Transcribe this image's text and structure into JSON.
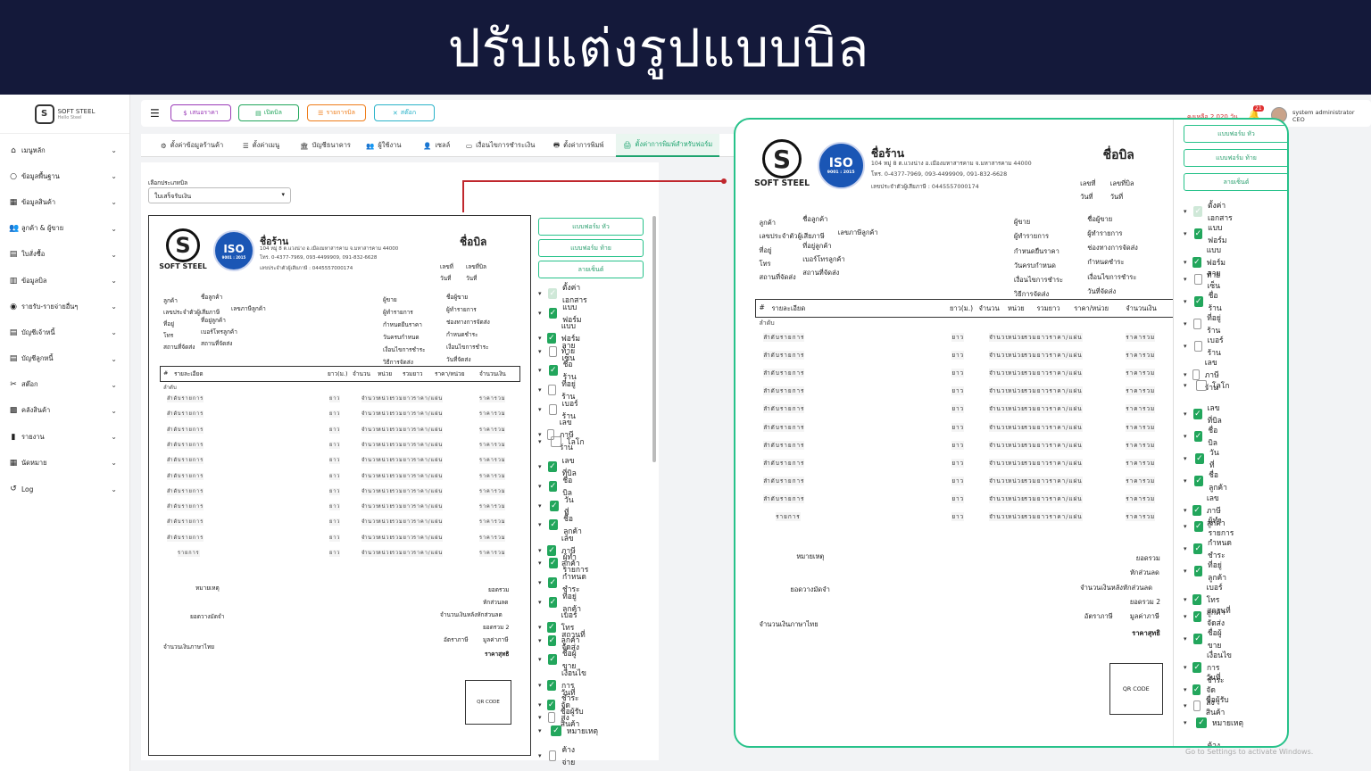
{
  "banner": {
    "title": "ปรับแต่งรูปแบบบิล"
  },
  "sidebar": {
    "logo_text": "SOFT STEEL",
    "logo_sub": "Hello Steel",
    "items": [
      {
        "label": "เมนูหลัก",
        "icon": "home-icon"
      },
      {
        "label": "ข้อมูลพื้นฐาน",
        "icon": "circle-icon"
      },
      {
        "label": "ข้อมูลสินค้า",
        "icon": "boxes-icon"
      },
      {
        "label": "ลูกค้า & ผู้ขาย",
        "icon": "users-icon"
      },
      {
        "label": "ใบสั่งซื้อ",
        "icon": "document-icon"
      },
      {
        "label": "ข้อมูลบิล",
        "icon": "bill-icon"
      },
      {
        "label": "รายรับ-รายจ่ายอื่นๆ",
        "icon": "coins-icon"
      },
      {
        "label": "บัญชีเจ้าหนี้",
        "icon": "ledger-icon"
      },
      {
        "label": "บัญชีลูกหนี้",
        "icon": "ledger-icon"
      },
      {
        "label": "สต๊อก",
        "icon": "tools-icon"
      },
      {
        "label": "คลังสินค้า",
        "icon": "warehouse-icon"
      },
      {
        "label": "รายงาน",
        "icon": "chart-icon"
      },
      {
        "label": "นัดหมาย",
        "icon": "calendar-icon"
      },
      {
        "label": "Log",
        "icon": "history-icon"
      }
    ]
  },
  "topbar": {
    "buttons": [
      {
        "label": "เสนอราคา",
        "icon": "$",
        "color": "#9b3bb8"
      },
      {
        "label": "เปิดบิล",
        "icon": "▤",
        "color": "#22a65c"
      },
      {
        "label": "รายการบิล",
        "icon": "☰",
        "color": "#ef7d1a"
      },
      {
        "label": "สต๊อก",
        "icon": "✕",
        "color": "#2ab3c9"
      }
    ],
    "credit": "คงเหลือ 2,020 วัน",
    "notif_count": "21",
    "user_name": "system administrator",
    "user_role": "CEO"
  },
  "tabs": [
    {
      "label": "ตั้งค่าข้อมูลร้านค้า",
      "icon": "⚙"
    },
    {
      "label": "ตั้งค่าเมนู",
      "icon": "☰"
    },
    {
      "label": "บัญชีธนาคาร",
      "icon": "🏛"
    },
    {
      "label": "ผู้ใช้งาน",
      "icon": "👥"
    },
    {
      "label": "เซลล์",
      "icon": "👤"
    },
    {
      "label": "เงื่อนไขการชำระเงิน",
      "icon": "▭"
    },
    {
      "label": "ตั้งค่าการพิมพ์",
      "icon": "🖶"
    },
    {
      "label": "ตั้งค่าการพิมพ์สำหรับฟอร์ม",
      "icon": "🖨"
    }
  ],
  "form_select": {
    "label": "เลือกประเภทบิล",
    "value": "ใบเสร็จรับเงิน"
  },
  "doc": {
    "logo_text": "SOFT STEEL",
    "iso": "ISO",
    "iso_sub": "9001 : 2015",
    "shop_name": "ชื่อร้าน",
    "bill_name": "ชื่อบิล",
    "address": "104 หมู่ 8 ต.แวงน่าง อ.เมืองมหาสารคาม จ.มหาสารคาม 44000",
    "phone": "โทร. 0-4377-7969, 093-4499909, 091-832-6628",
    "taxid": "เลขประจำตัวผู้เสียภาษี : 0445557000174",
    "bill_no_label": "เลขที่",
    "bill_no_value": "เลขที่บิล",
    "date_label": "วันที่",
    "date_value": "วันที่",
    "cust_labels": [
      "ลูกค้า",
      "เลขประจำตัวผู้เสียภาษี",
      "ที่อยู่",
      "โทร",
      "สถานที่จัดส่ง"
    ],
    "cust_values": [
      "ชื่อลูกค้า",
      "เลขภาษีลูกค้า",
      "ที่อยู่ลูกค้า",
      "เบอร์โทรลูกค้า",
      "สถานที่จัดส่ง"
    ],
    "seller_labels": [
      "ผู้ขาย",
      "ผู้ทำรายการ",
      "กำหนดยืนราคา",
      "วันครบกำหนด",
      "เงื่อนไขการชำระ",
      "วิธีการจัดส่ง"
    ],
    "seller_values": [
      "ชื่อผู้ขาย",
      "ผู้ทำรายการ",
      "ช่องทางการจัดส่ง",
      "กำหนดชำระ",
      "เงื่อนไขการชำระ",
      "วันที่จัดส่ง"
    ],
    "table_headers": [
      "#",
      "รายละเอียด",
      "ยาว(ม.)",
      "จำนวน",
      "หน่วย",
      "รวมยาว",
      "ราคา/หน่วย",
      "จำนวนเงิน"
    ],
    "first_row_label": "ลำดับ",
    "row_cells": [
      "ลำดับรายการ",
      "ยาว",
      "จำนวน",
      "หน่วย",
      "รวมยาว",
      "ราคา/แผ่น",
      "ราคารวม"
    ],
    "last_row_cells": [
      "รายการ",
      "ยาว",
      "จำนวน",
      "หน่วย",
      "รวมยาว",
      "ราคา/แผ่น",
      "ราคารวม"
    ],
    "remark": "หมายเหตุ",
    "deposit": "ยอดวางมัดจำ",
    "thai_amount": "จำนวนเงินภาษาไทย",
    "sum_labels": [
      "ยอดรวม",
      "หักส่วนลด",
      "จำนวนเงินหลังหักส่วนลด",
      "ยอดรวม 2"
    ],
    "vat_label": "อัตราภาษี",
    "vat_value": "มูลค่าภาษี",
    "net": "ราคาสุทธิ",
    "qr": "QR CODE"
  },
  "controls": {
    "buttons": [
      "แบบฟอร์ม หัว",
      "แบบฟอร์ม ท้าย",
      "ลายเซ็นต์"
    ],
    "options": [
      {
        "label": "ตั้งค่าเอกสาร",
        "checked": true,
        "disabled": true
      },
      {
        "label": "แบบฟอร์ม",
        "checked": true
      },
      {
        "label": "แบบฟอร์มท้าย",
        "checked": true
      },
      {
        "label": "ลายเซ็น",
        "checked": false
      },
      {
        "label": "ชื่อร้าน",
        "checked": true
      },
      {
        "label": "ที่อยู่ร้าน",
        "checked": false
      },
      {
        "label": "เบอร์ร้าน",
        "checked": false
      },
      {
        "label": "เลขภาษีร้าน",
        "checked": false
      },
      {
        "label": "โลโก",
        "checked": false
      },
      {
        "label": "เลขที่บิล",
        "checked": true
      },
      {
        "label": "ชื่อบิล",
        "checked": true
      },
      {
        "label": "วันที่",
        "checked": true
      },
      {
        "label": "ชื่อลูกค้า",
        "checked": true
      },
      {
        "label": "เลขภาษีลูกค้า",
        "checked": true
      },
      {
        "label": "ผู้ทำรายการ",
        "checked": true
      },
      {
        "label": "กำหนดชำระ",
        "checked": true
      },
      {
        "label": "ที่อยู่ลูกค้า",
        "checked": true
      },
      {
        "label": "เบอร์โทรลูกค้า",
        "checked": true
      },
      {
        "label": "สถานที่จัดส่ง",
        "checked": true
      },
      {
        "label": "ชื่อผู้ขาย",
        "checked": true
      },
      {
        "label": "เงื่อนไขการชำระ",
        "checked": true
      },
      {
        "label": "วันที่จัดส่ง",
        "checked": true
      },
      {
        "label": "ชื่อผู้รับสินค้า",
        "checked": false
      },
      {
        "label": "หมายเหตุ",
        "checked": true
      },
      {
        "label": "ค้างจ่าย",
        "checked": false
      }
    ]
  },
  "watermark": "Go to Settings to activate Windows.",
  "colors": {
    "accent": "#27c28a",
    "banner": "#14193a",
    "arrow": "#c0272d"
  }
}
